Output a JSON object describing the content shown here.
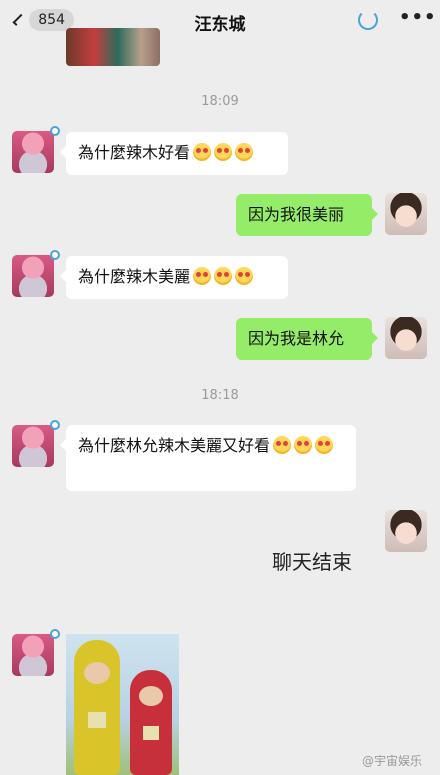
{
  "header": {
    "back_badge": "854",
    "title": "汪东城"
  },
  "messages": {
    "time1": "18:09",
    "msg1": "為什麼辣木好看",
    "msg2": "因为我很美丽",
    "msg3": "為什麼辣木美麗",
    "msg4": "因为我是林允",
    "time2": "18:18",
    "msg5": "為什麼林允辣木美麗又好看",
    "msg6": "聊天结束"
  },
  "watermark": "@宇宙娱乐",
  "icons": [
    "back-chevron-icon",
    "loading-icon",
    "more-icon",
    "heart-eyes-emoji-icon",
    "verified-icon"
  ],
  "colors": {
    "background": "#ededed",
    "sent_bubble": "#95ec69",
    "received_bubble": "#ffffff",
    "accent": "#4aa3d8"
  }
}
